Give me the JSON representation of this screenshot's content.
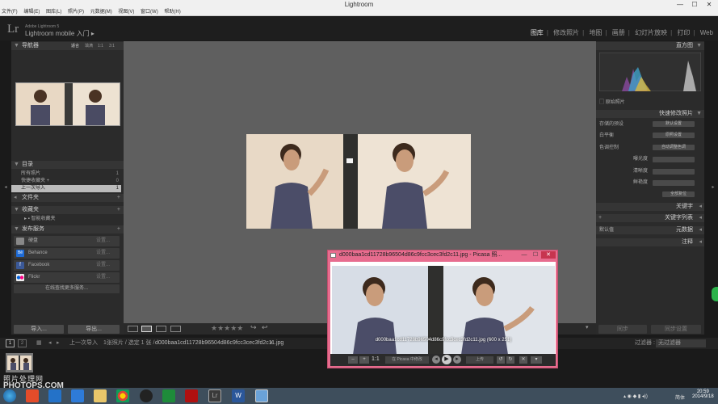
{
  "window": {
    "title": "Lightroom",
    "minimize": "—",
    "maximize": "☐",
    "close": "✕"
  },
  "menu": [
    "文件(F)",
    "编辑(E)",
    "图库(L)",
    "照片(P)",
    "元数据(M)",
    "视图(V)",
    "窗口(W)",
    "帮助(H)"
  ],
  "identity": {
    "logo": "Lr",
    "product_small": "Adobe Lightroom 5",
    "product": "Lightroom mobile 入门",
    "arrow": "▸"
  },
  "modules": [
    "图库",
    "修改照片",
    "地图",
    "画册",
    "幻灯片放映",
    "打印",
    "Web"
  ],
  "navigator": {
    "title": "导航器",
    "opts": [
      "适合",
      "填满",
      "1:1",
      "3:1"
    ]
  },
  "catalog": {
    "title": "目录",
    "items": [
      {
        "label": "所有照片",
        "count": "1"
      },
      {
        "label": "快捷收藏夹 +",
        "count": "0"
      },
      {
        "label": "上一次导入",
        "count": "1"
      }
    ]
  },
  "folders": {
    "title": "文件夹",
    "plus": "+"
  },
  "collections": {
    "title": "收藏夹",
    "plus": "+",
    "smart": "智能收藏夹"
  },
  "publish": {
    "title": "发布服务",
    "plus": "+",
    "services": [
      {
        "label": "硬盘",
        "action": "设置..."
      },
      {
        "label": "Behance",
        "action": "设置..."
      },
      {
        "label": "Facebook",
        "action": "设置..."
      },
      {
        "label": "Flickr",
        "action": "设置..."
      }
    ],
    "more": "在线查找更多服务..."
  },
  "buttons": {
    "import": "导入...",
    "export": "导出...",
    "sync": "同步",
    "sync_settings": "同步设置"
  },
  "right": {
    "histogram": "直方图",
    "original": "原始照片",
    "quick_develop": "快速修改照片",
    "saved_preset": "存储的预设",
    "saved_preset_val": "默认设置",
    "white_balance": "白平衡",
    "white_balance_val": "原照设置",
    "tone_control": "色调控制",
    "auto_tone": "自动调整色调",
    "exposure": "曝光度",
    "clarity": "清晰度",
    "vibrance": "鲜艳度",
    "reset_all": "全部复位",
    "keywording": "关键字",
    "keyword_list": "关键字列表",
    "default": "默认值",
    "metadata": "元数据",
    "comments": "注释"
  },
  "filmbar": {
    "page1": "1",
    "page2": "2",
    "source": "上一次导入",
    "info": "1张照片 / 选定 1 张 /",
    "filename": "d000baa1cd11728b96504d86c9fcc3cec3fd2c11.jpg",
    "dropdown": "▾",
    "filter_label": "过滤器 :",
    "filter_value": "无过滤器"
  },
  "picasa": {
    "title": "d000baa1cd11728b96504d86c9fcc3cec3fd2c11.jpg - Picasa 照...",
    "caption": "d000baa1cd11728b96504d86c9fcc3cec3fd2c11.jpg (600 x 251)",
    "ratio": "1:1",
    "open_in": "在 Picasa 中修改",
    "upload": "上传"
  },
  "watermark": {
    "line1": "照片处理网",
    "line2": "PHOTOPS.COM"
  },
  "clock": {
    "time": "20:59",
    "date": "2014/9/18",
    "lang": "简体"
  },
  "colors": {
    "bg": "#1a1a1a",
    "panel": "#2b2b2b",
    "center": "#5f5f5f",
    "picasa_frame": "#e76c8e",
    "taskbar": "#3e4e5c"
  }
}
